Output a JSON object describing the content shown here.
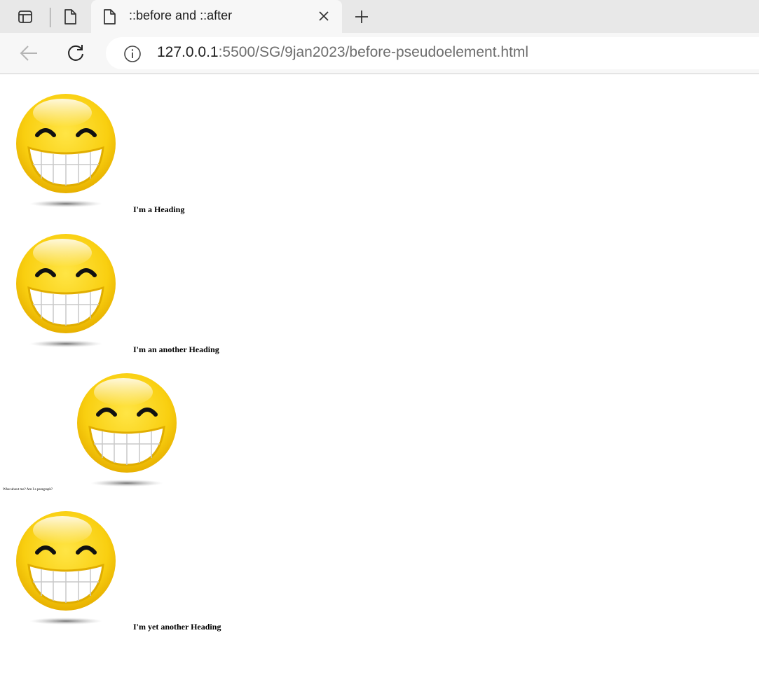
{
  "browser": {
    "tab": {
      "title": "::before and ::after"
    },
    "address_bar": {
      "host": "127.0.0.1",
      "path": ":5500/SG/9jan2023/before-pseudoelement.html"
    }
  },
  "page": {
    "heading_1": "I'm a Heading",
    "heading_2": "I'm an another Heading",
    "paragraph": "What about me? Am I a paragraph?",
    "heading_3": "I'm yet another Heading"
  },
  "colors": {
    "smiley_face": "#f7c80d",
    "smiley_outline": "#e0ad00",
    "tab_strip": "#e8e8e8",
    "toolbar": "#f7f7f7"
  }
}
